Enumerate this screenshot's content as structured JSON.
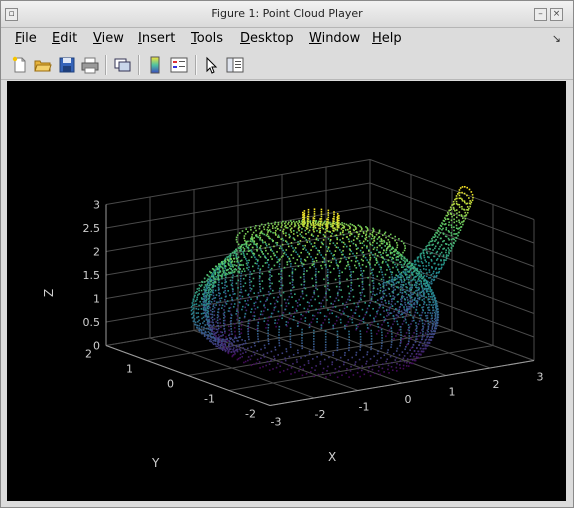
{
  "window": {
    "title": "Figure 1: Point Cloud Player"
  },
  "menubar": {
    "items": [
      {
        "label": "File",
        "key": "F"
      },
      {
        "label": "Edit",
        "key": "E"
      },
      {
        "label": "View",
        "key": "V"
      },
      {
        "label": "Insert",
        "key": "I"
      },
      {
        "label": "Tools",
        "key": "T"
      },
      {
        "label": "Desktop",
        "key": "D"
      },
      {
        "label": "Window",
        "key": "W"
      },
      {
        "label": "Help",
        "key": "H"
      }
    ]
  },
  "toolbar": {
    "icons": [
      "new-figure-icon",
      "open-file-icon",
      "save-icon",
      "print-icon",
      "link-plot-icon",
      "insert-colorbar-icon",
      "insert-legend-icon",
      "select-arrow-icon",
      "property-editor-icon"
    ]
  },
  "colors": {
    "plot_background": "#000000",
    "axis_text": "#cfcfcf",
    "grid": "#4a4a4a",
    "colormap": [
      "#440154",
      "#3b528b",
      "#21908d",
      "#5dc963",
      "#fde725"
    ]
  },
  "plot": {
    "xlabel": "X",
    "ylabel": "Y",
    "zlabel": "Z",
    "xticks": [
      "-3",
      "-2",
      "-1",
      "0",
      "1",
      "2",
      "3"
    ],
    "yticks": [
      "-2",
      "-1",
      "0",
      "1",
      "2"
    ],
    "zticks": [
      "0",
      "0.5",
      "1",
      "1.5",
      "2",
      "2.5",
      "3"
    ],
    "colormap_name": "parula-like (blue to yellow by height)"
  }
}
